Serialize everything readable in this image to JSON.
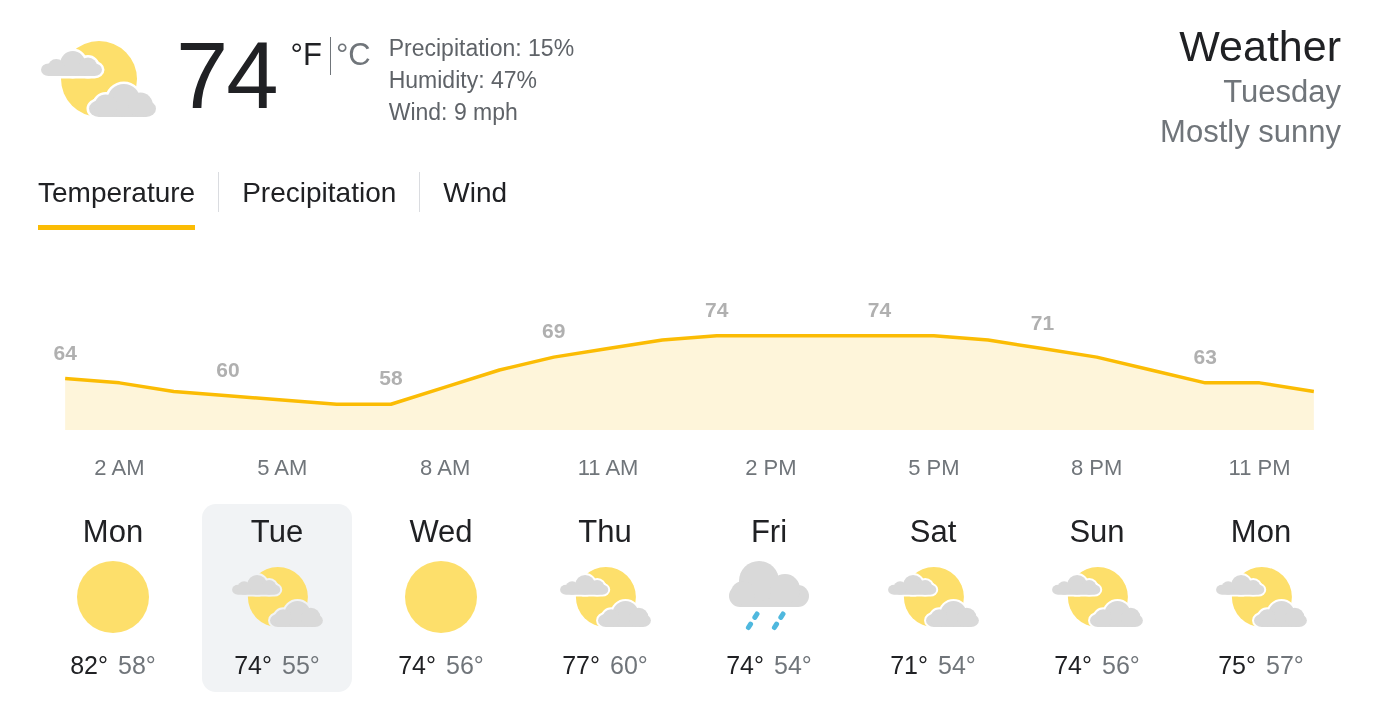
{
  "current": {
    "temperature": "74",
    "units": [
      {
        "label": "°F",
        "selected": true
      },
      {
        "label": "°C",
        "selected": false
      }
    ],
    "details": [
      "Precipitation: 15%",
      "Humidity: 47%",
      "Wind: 9 mph"
    ]
  },
  "summary": {
    "title": "Weather",
    "day": "Tuesday",
    "condition": "Mostly sunny"
  },
  "tabs": [
    {
      "label": "Temperature",
      "selected": true
    },
    {
      "label": "Precipitation",
      "selected": false
    },
    {
      "label": "Wind",
      "selected": false
    }
  ],
  "chart": {
    "chart_data": {
      "type": "area",
      "categories": [
        null,
        "2 AM",
        null,
        null,
        "5 AM",
        null,
        null,
        "8 AM",
        null,
        null,
        "11 AM",
        null,
        null,
        "2 PM",
        null,
        null,
        "5 PM",
        null,
        null,
        "8 PM",
        null,
        null,
        "11 PM",
        null
      ],
      "values": [
        64,
        63,
        61,
        60,
        59,
        58,
        58,
        62,
        66,
        69,
        71,
        73,
        74,
        74,
        74,
        74,
        74,
        73,
        71,
        69,
        66,
        63,
        63,
        61
      ],
      "color": "#fbbc04",
      "value_labels": [
        "64",
        null,
        null,
        "60",
        null,
        null,
        "58",
        null,
        null,
        "69",
        null,
        null,
        "74",
        null,
        null,
        "74",
        null,
        null,
        "71",
        null,
        null,
        "63",
        null,
        null
      ],
      "tick_labels": "x"
    }
  },
  "days": [
    {
      "name": "Mon",
      "kind": "sun",
      "high": "82°",
      "low": "58°",
      "selected": false
    },
    {
      "name": "Tue",
      "kind": "partly_cloudy",
      "high": "74°",
      "low": "55°",
      "selected": true
    },
    {
      "name": "Wed",
      "kind": "sun",
      "high": "74°",
      "low": "56°",
      "selected": false
    },
    {
      "name": "Thu",
      "kind": "partly_cloudy",
      "high": "77°",
      "low": "60°",
      "selected": false
    },
    {
      "name": "Fri",
      "kind": "rain",
      "high": "74°",
      "low": "54°",
      "selected": false
    },
    {
      "name": "Sat",
      "kind": "partly_cloudy",
      "high": "71°",
      "low": "54°",
      "selected": false
    },
    {
      "name": "Sun",
      "kind": "partly_cloudy",
      "high": "74°",
      "low": "56°",
      "selected": false
    },
    {
      "name": "Mon",
      "kind": "partly_cloudy",
      "high": "75°",
      "low": "57°",
      "selected": false
    }
  ]
}
